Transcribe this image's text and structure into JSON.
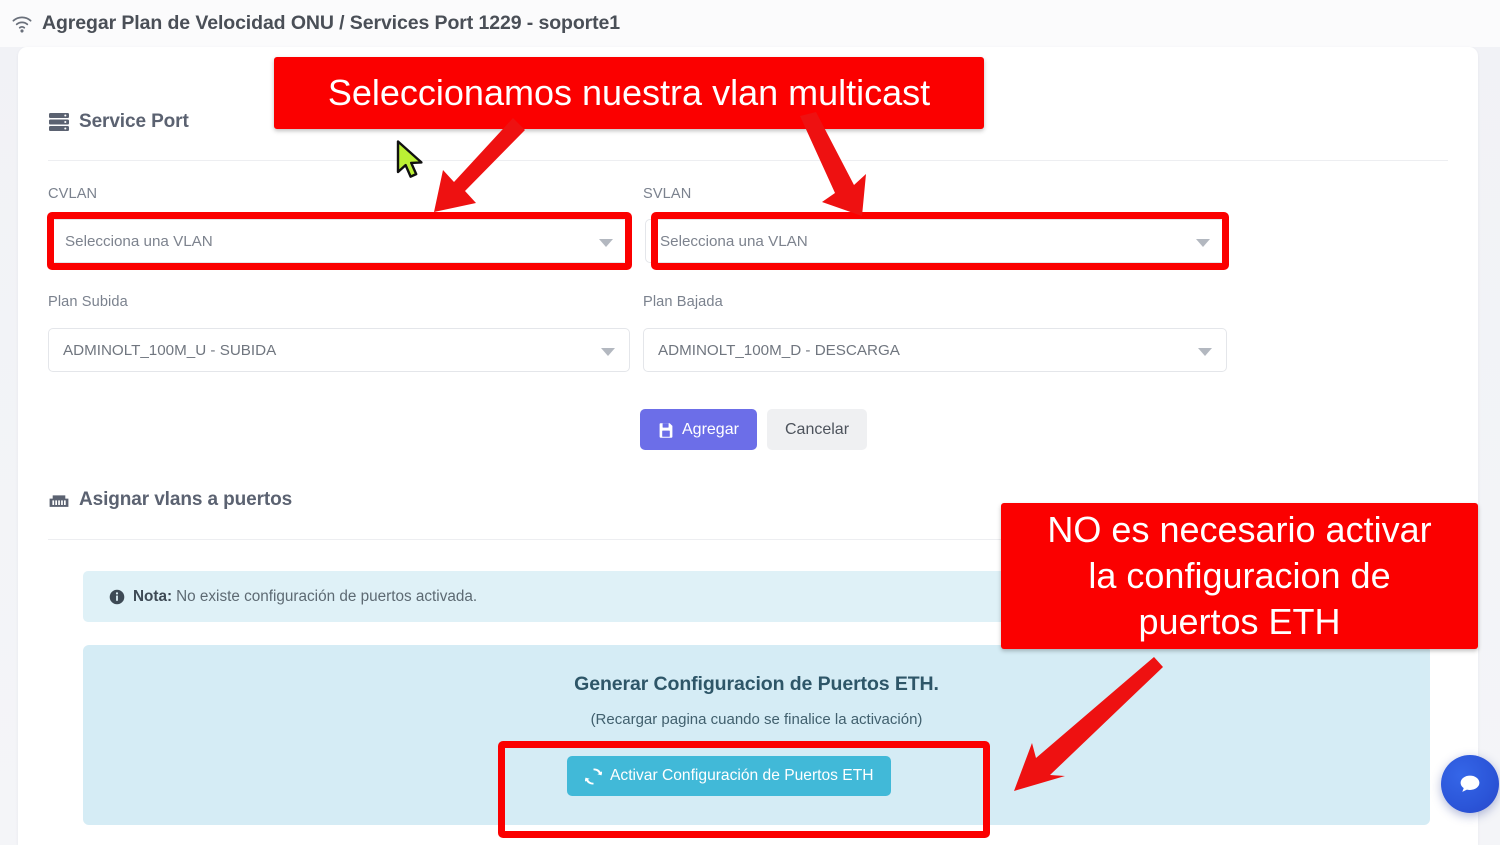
{
  "page": {
    "title": "Agregar Plan de Velocidad ONU / Services Port 1229 - soporte1",
    "title_icon": "wifi-icon"
  },
  "service_port": {
    "heading": "Service Port",
    "heading_icon": "server-stack-icon",
    "fields": {
      "cvlan": {
        "label": "CVLAN",
        "value": "",
        "placeholder": "Selecciona una VLAN",
        "caret_icon": "chevron-down-icon"
      },
      "svlan": {
        "label": "SVLAN",
        "value": "",
        "placeholder": "Selecciona una VLAN",
        "caret_icon": "chevron-down-icon"
      },
      "plan_subida": {
        "label": "Plan Subida",
        "value": "ADMINOLT_100M_U - SUBIDA",
        "caret_icon": "chevron-down-icon"
      },
      "plan_bajada": {
        "label": "Plan Bajada",
        "value": "ADMINOLT_100M_D - DESCARGA",
        "caret_icon": "chevron-down-icon"
      }
    },
    "actions": {
      "submit_label": "Agregar",
      "submit_icon": "save-icon",
      "submit_color": "#6c6ee8",
      "cancel_label": "Cancelar",
      "cancel_color": "#eff0f2"
    }
  },
  "assign_vlans": {
    "heading": "Asignar vlans a puertos",
    "heading_icon": "ethernet-port-icon",
    "note": {
      "icon": "info-circle-icon",
      "strong": "Nota:",
      "text": "No existe configuración de puertos activada.",
      "background": "#dff1f7"
    },
    "eth_panel": {
      "heading": "Generar Configuracion de Puertos ETH.",
      "subtext": "(Recargar pagina cuando se finalice la activación)",
      "button_label": "Activar Configuración de Puertos ETH",
      "button_icon": "sync-icon",
      "button_color": "#41b9d8",
      "background": "#d5ecf5"
    }
  },
  "annotations": {
    "color": "#fb0000",
    "banner_top": {
      "lines": [
        "Seleccionamos nuestra vlan multicast"
      ]
    },
    "banner_right": {
      "lines": [
        "NO es necesario activar",
        "la configuracion de",
        "puertos ETH"
      ]
    },
    "arrows": [
      "arrow-to-cvlan",
      "arrow-to-svlan",
      "arrow-to-activar-button"
    ],
    "highlight_boxes": [
      "cvlan-select",
      "svlan-select",
      "activar-button"
    ]
  },
  "chat_widget": {
    "icon": "chat-bubble-icon",
    "color": "#2b55d8"
  },
  "cursor": {
    "icon": "mouse-pointer-icon",
    "fill": "#bbf034"
  }
}
